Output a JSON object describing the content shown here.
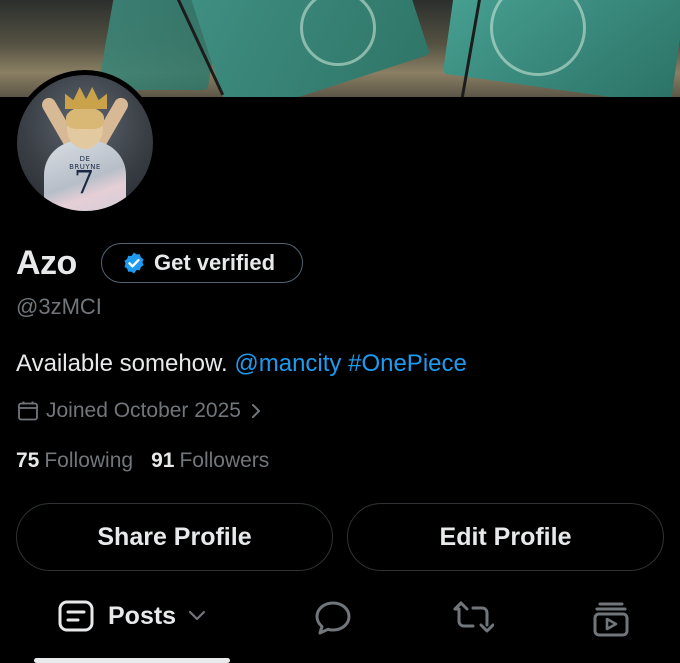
{
  "profile": {
    "display_name": "Azo",
    "handle": "@3zMCI",
    "verify_label": "Get verified",
    "bio_text": "Available somehow.",
    "bio_mention": "@mancity",
    "bio_hashtag": "#OnePiece",
    "joined": "Joined October 2025",
    "following_count": "75",
    "following_label": "Following",
    "followers_count": "91",
    "followers_label": "Followers",
    "avatar_shirt_name": "DE BRUYNE",
    "avatar_shirt_number": "7"
  },
  "actions": {
    "share_label": "Share Profile",
    "edit_label": "Edit Profile"
  },
  "tabs": {
    "posts_label": "Posts",
    "icons": [
      "posts-icon",
      "chevron-down-icon",
      "replies-icon",
      "repost-icon",
      "media-icon"
    ]
  },
  "colors": {
    "background": "#000000",
    "text_primary": "#e7e9ea",
    "text_secondary": "#71767b",
    "link": "#1d9bf0",
    "border": "#2f3336",
    "verified_badge": "#1d9bf0"
  }
}
